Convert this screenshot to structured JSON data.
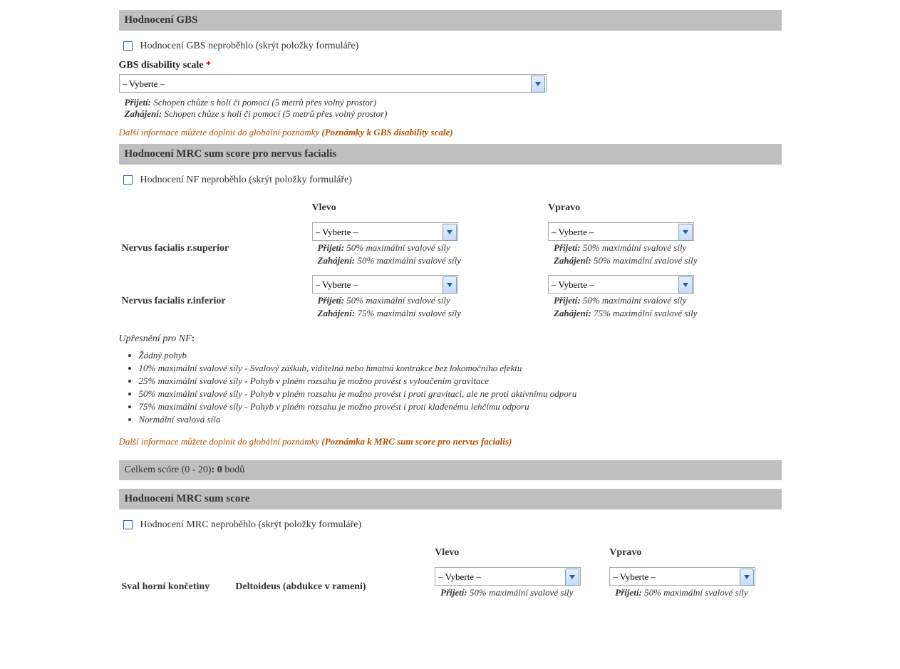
{
  "select_placeholder": "– Vyberte –",
  "gbs": {
    "header": "Hodnocení GBS",
    "skip_label": "Hodnocení GBS neproběhlo (skrýt položky formuláře)",
    "disability_label": "GBS disability scale",
    "prijeti_label": "Přijetí:",
    "prijeti_value": "Schopen chůze s holí či pomocí (5 metrů přes volný prostor)",
    "zahajeni_label": "Zahájení:",
    "zahajeni_value": "Schopen chůze s holí či pomocí (5 metrů přes volný prostor)",
    "note_prefix": "Další informace můžete doplnit do globální poznámky",
    "note_bold": "(Poznámky k GBS disability scale)"
  },
  "nf": {
    "header": "Hodnocení MRC sum score pro nervus facialis",
    "skip_label": "Hodnocení NF neproběhlo (skrýt položky formuláře)",
    "col_left": "Vlevo",
    "col_right": "Vpravo",
    "rows": [
      {
        "label": "Nervus facialis r.superior",
        "left": {
          "prijeti": "50% maximální svalové síly",
          "zahajeni": "50% maximální svalové síly"
        },
        "right": {
          "prijeti": "50% maximální svalové síly",
          "zahajeni": "50% maximální svalové síly"
        }
      },
      {
        "label": "Nervus facialis r.inferior",
        "left": {
          "prijeti": "50% maximální svalové síly",
          "zahajeni": "75% maximální svalové síly"
        },
        "right": {
          "prijeti": "50% maximální svalové síly",
          "zahajeni": "75% maximální svalové síly"
        }
      }
    ],
    "sublabels": {
      "prijeti": "Přijetí:",
      "zahajeni": "Zahájení:"
    },
    "uprest_label": "Upřesnění pro NF",
    "uprest_colon": ":",
    "scale": [
      "Žádný pohyb",
      "10% maximální svalové síly - Svalový záškub, viditelná nebo hmatná kontrakce bez lokomočního efektu",
      "25% maximální svalové síly - Pohyb v plném rozsahu je možno provést s vyloučením gravitace",
      "50% maximální svalové síly - Pohyb v plném rozsahu je možno provést i proti gravitaci, ale ne proti aktivnímu odporu",
      "75% maximální svalové síly - Pohyb v plném rozsahu je možno provést i proti kladenému lehčímu odporu",
      "Normální svalová síla"
    ],
    "note_prefix": "Další informace můžete doplnit do globální poznámky",
    "note_bold": "(Poznámka k MRC sum score pro nervus facialis)",
    "score_label_a": "Celkem scóre (0 - 20)",
    "score_label_b": ": ",
    "score_value": "0",
    "score_unit": " bodů"
  },
  "mrc": {
    "header": "Hodnocení MRC sum score",
    "skip_label": "Hodnocení MRC neproběhlo (skrýt položky formuláře)",
    "col_left": "Vlevo",
    "col_right": "Vpravo",
    "group_label": "Sval horní končetiny",
    "row1_label": "Deltoideus (abdukce v rameni)",
    "sublabels": {
      "prijeti": "Přijetí:"
    },
    "left": {
      "prijeti": "50% maximální svalové síly"
    },
    "right": {
      "prijeti": "50% maximální svalové síly"
    }
  }
}
